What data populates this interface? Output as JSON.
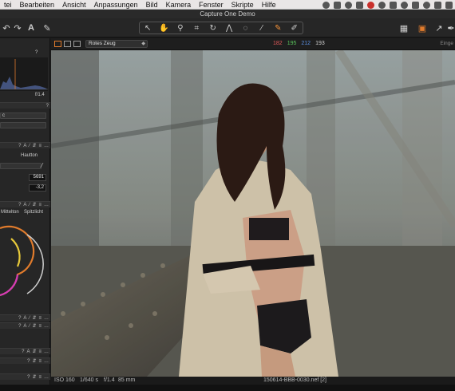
{
  "menubar": {
    "items": [
      "tei",
      "Bearbeiten",
      "Ansicht",
      "Anpassungen",
      "Bild",
      "Kamera",
      "Fenster",
      "Skripte",
      "Hilfe"
    ]
  },
  "window": {
    "title": "Capture One Demo"
  },
  "viewer": {
    "style_select": "Rotes Zeug",
    "rgb": {
      "r": "182",
      "g": "195",
      "b": "212",
      "l": "193"
    },
    "right_label": "Einge",
    "colors": {
      "r": "#e05a5a",
      "g": "#59c25c",
      "b": "#5a8ee0",
      "l": "#cfcfcf"
    }
  },
  "left_panel": {
    "histogram_aperture": "f/1.4",
    "field1": "c",
    "wb_tab_label": "Hautton",
    "kelvin": "5691",
    "tint": "-3,2",
    "tabs": {
      "mid": "Mittelton",
      "high": "Spitzlicht"
    }
  },
  "status": {
    "iso": "ISO 160",
    "shutter": "1/640 s",
    "aperture": "f/1.4",
    "focal": "85 mm",
    "filename": "150614-BBB-0030.nef [2]"
  },
  "accent_color": "#e07b2c"
}
